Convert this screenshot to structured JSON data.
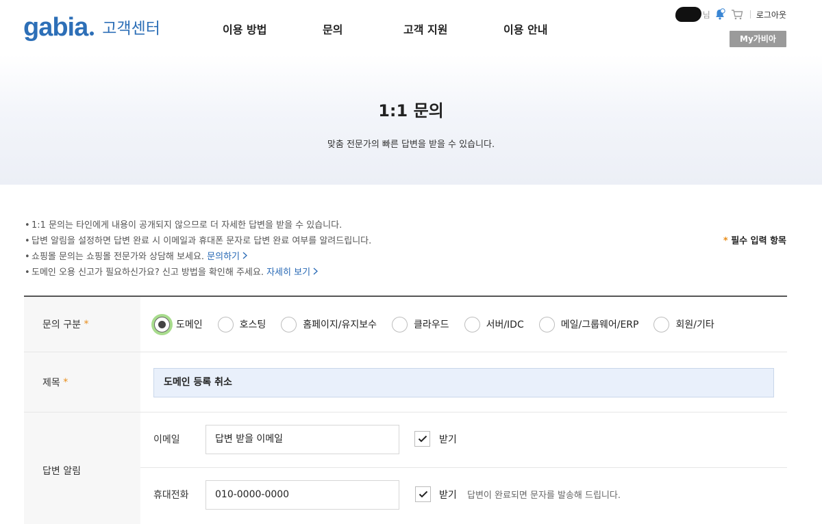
{
  "header": {
    "logo_text": "gabia",
    "logo_sub": "고객센터",
    "nav": [
      "이용 방법",
      "문의",
      "고객 지원",
      "이용 안내"
    ],
    "user_suffix": "님",
    "logout_label": "로그아웃",
    "my_button_label": "My가비아"
  },
  "hero": {
    "title": "1:1 문의",
    "subtitle": "맞춤 전문가의 빠른 답변을 받을 수 있습니다."
  },
  "notes": {
    "items": [
      {
        "text": "1:1 문의는 타인에게 내용이 공개되지 않으므로 더 자세한 답변을 받을 수 있습니다.",
        "link": ""
      },
      {
        "text": "답변 알림을 설정하면 답변 완료 시 이메일과 휴대폰 문자로 답변 완료 여부를 알려드립니다.",
        "link": ""
      },
      {
        "text": "쇼핑몰 문의는 쇼핑몰 전문가와 상담해 보세요. ",
        "link": "문의하기"
      },
      {
        "text": "도메인 오용 신고가 필요하신가요? 신고 방법을 확인해 주세요. ",
        "link": "자세히 보기"
      }
    ],
    "required_label": "필수 입력 항목",
    "required_mark": "*"
  },
  "form": {
    "category": {
      "label": "문의 구분",
      "options": [
        "도메인",
        "호스팅",
        "홈페이지/유지보수",
        "클라우드",
        "서버/IDC",
        "메일/그룹웨어/ERP",
        "회원/기타"
      ],
      "selected_index": 0
    },
    "subject": {
      "label": "제목",
      "value": "도메인 등록 취소"
    },
    "notify": {
      "label": "답변 알림",
      "email_label": "이메일",
      "email_value": "답변 받을 이메일",
      "email_checked": true,
      "email_check_label": "받기",
      "phone_label": "휴대전화",
      "phone_value": "010-0000-0000",
      "phone_checked": true,
      "phone_check_label": "받기",
      "phone_hint": "답변이 완료되면 문자를 발송해 드립니다."
    }
  },
  "colors": {
    "brand": "#2d6fb7",
    "required_star": "#e88d1a",
    "radio_focus": "#a8dc8d"
  }
}
